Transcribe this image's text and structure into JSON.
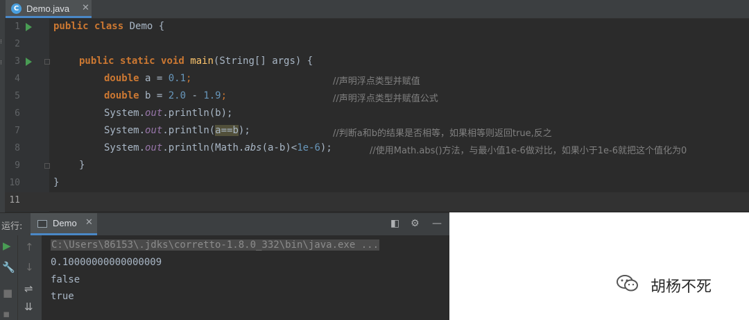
{
  "editor_tab": {
    "icon": "java-class-icon",
    "filename": "Demo.java",
    "close": "✕"
  },
  "code_lines": [
    {
      "num": "1"
    },
    {
      "num": "2"
    },
    {
      "num": "3"
    },
    {
      "num": "4"
    },
    {
      "num": "5"
    },
    {
      "num": "6"
    },
    {
      "num": "7"
    },
    {
      "num": "8"
    },
    {
      "num": "9"
    },
    {
      "num": "10"
    },
    {
      "num": "11"
    }
  ],
  "code": {
    "l1": {
      "kw1": "public",
      "kw2": "class",
      "name": " Demo {"
    },
    "l3": {
      "kw1": "public",
      "kw2": "static",
      "kw3": "void",
      "fn": "main",
      "rest": "(String[] args) {"
    },
    "l4": {
      "kw": "double",
      "mid": " a = ",
      "num": "0.1",
      "end": ";",
      "comment": "//声明浮点类型并赋值"
    },
    "l5": {
      "kw": "double",
      "mid": " b = ",
      "num1": "2.0",
      "op": " - ",
      "num2": "1.9",
      "end": ";",
      "comment": "//声明浮点类型并赋值公式"
    },
    "l6": {
      "cls": "System.",
      "field": "out",
      "rest": ".println(b);"
    },
    "l7": {
      "cls": "System.",
      "field": "out",
      "pre": ".println(",
      "hl": "a==b",
      "post": ");",
      "comment": "//判断a和b的结果是否相等，如果相等则返回true,反之"
    },
    "l8": {
      "cls": "System.",
      "field": "out",
      "pre": ".println(Math.",
      "fn": "abs",
      "mid": "(a-b)<",
      "num": "1e-6",
      "end": ");",
      "comment": "//使用Math.abs()方法，与最小值1e-6做对比，如果小于1e-6就把这个值化为0"
    },
    "l9": {
      "text": "}"
    },
    "l10": {
      "text": "}"
    }
  },
  "run_panel": {
    "label": "运行:",
    "tab_name": "Demo",
    "close": "✕",
    "toolbar_icons": [
      "layout-icon",
      "gear-icon",
      "minimize-icon"
    ]
  },
  "console": {
    "command": "C:\\Users\\86153\\.jdks\\corretto-1.8.0_332\\bin\\java.exe ...",
    "output": [
      "0.10000000000000009",
      "false",
      "true"
    ]
  },
  "side_icons": [
    "run-icon",
    "up-arrow-icon",
    "wrench-icon",
    "down-arrow-icon",
    "stop-icon",
    "soft-wrap-icon",
    "scroll-to-end-icon"
  ],
  "watermark": {
    "icon": "wechat-icon",
    "text": "胡杨不死"
  },
  "colors": {
    "bg": "#2b2b2b",
    "keyword": "#cc7832",
    "number": "#6897bb",
    "function": "#ffc66d",
    "comment": "#808080",
    "run_green": "#499c54"
  }
}
